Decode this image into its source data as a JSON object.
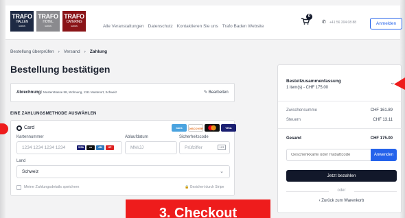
{
  "header": {
    "logos": [
      {
        "main": "TRAFO",
        "sub": "HALLEN",
        "tiny": "BADEN"
      },
      {
        "main": "TRAFO",
        "sub": "HOTEL",
        "tiny": "BADEN"
      },
      {
        "main": "TRAFO",
        "sub": "CATERING",
        "tiny": "BADEN"
      }
    ],
    "nav": [
      "Alle Veranstaltungen",
      "Datenschutz",
      "Kontaktieren Sie uns",
      "Trafo Baden Website"
    ],
    "cart_count": "0",
    "phone": "+41 56 204 08 88",
    "login_label": "Anmelden"
  },
  "breadcrumb": [
    "Bestellung überprüfen",
    "Versand",
    "Zahlung"
  ],
  "page_title": "Bestellung bestätigen",
  "billing": {
    "label": "Abrechnung:",
    "address": "Musterstrasse 58, Wohnung, 1111 Musterort, Schweiz",
    "edit_label": "Bearbeiten"
  },
  "payment": {
    "section_title": "EINE ZAHLUNGSMETHODE AUSWÄHLEN",
    "method_label": "Card",
    "brands": [
      "bank",
      "DISCOVER",
      "MC",
      "VISA"
    ],
    "card_number_label": "Kartennummer",
    "card_number_placeholder": "1234 1234 1234 1234",
    "expiry_label": "Ablaufdatum",
    "expiry_placeholder": "MM/JJ",
    "cvc_label": "Sicherheitscode",
    "cvc_placeholder": "Prüfziffer",
    "country_label": "Land",
    "country_value": "Schweiz",
    "save_label": "Meine Zahlungsdetails speichern",
    "stripe_label": "Gesichert durch Stripe"
  },
  "summary": {
    "title": "Bestellzusammenfassung",
    "items": "1 item(s) -  CHF 175.00",
    "subtotal_label": "Zwischensumme",
    "subtotal_value": "CHF 161.89",
    "tax_label": "Steuern",
    "tax_value": "CHF 13.11",
    "total_label": "Gesamt",
    "total_value": "CHF 175.00",
    "voucher_placeholder": "Geschenkkarte oder Rabattcode",
    "apply_label": "Anwenden",
    "pay_label": "Jetzt bezahlen",
    "or_label": "oder",
    "back_label": "Zurück zum Warenkorb"
  },
  "banner": "3. Checkout",
  "colors": {
    "accent": "#2563eb",
    "dark": "#12182a",
    "banner": "#ee1c1c",
    "logo_navy": "#1e2a44",
    "logo_grey": "#8a8a8e",
    "logo_red": "#8a1418"
  }
}
